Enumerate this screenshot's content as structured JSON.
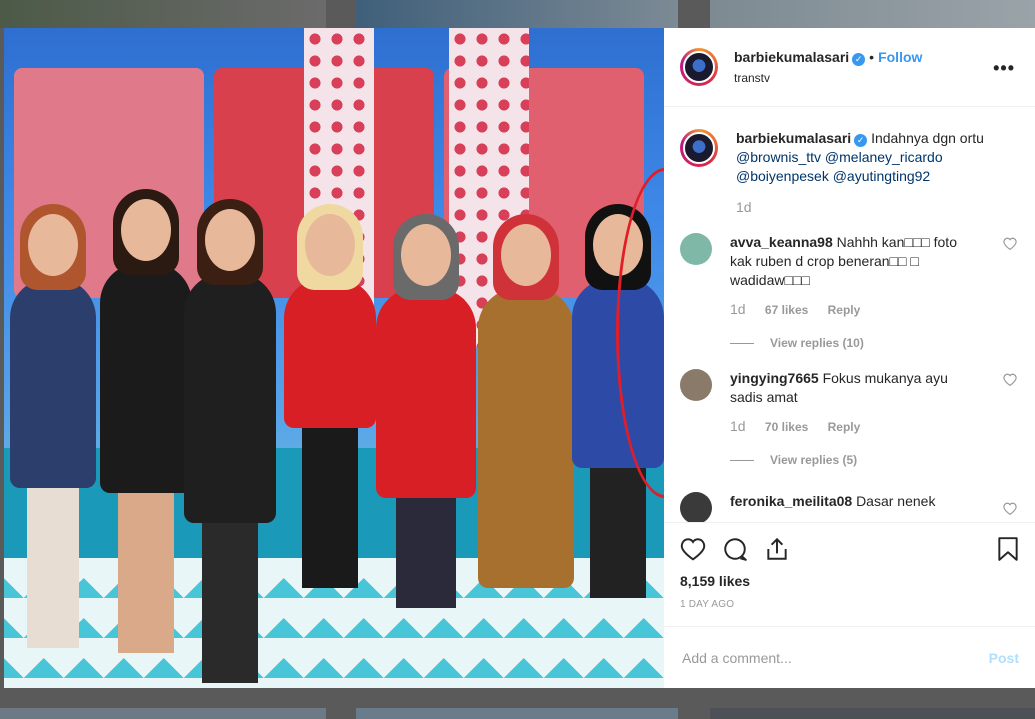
{
  "post": {
    "username": "barbiekumalasari",
    "follow_label": "Follow",
    "location": "transtv",
    "more_label": "•••"
  },
  "caption": {
    "username": "barbiekumalasari",
    "text_before": "Indahnya dgn ortu",
    "mentions": [
      "@brownis_ttv",
      "@melaney_ricardo",
      "@boiyenpesek",
      "@ayutingting92"
    ],
    "time": "1d"
  },
  "comments": [
    {
      "username": "avva_keanna98",
      "text": "Nahhh kan□□□ foto kak ruben d crop beneran□□ □ wadidaw□□□",
      "time": "1d",
      "likes": "67 likes",
      "reply_label": "Reply",
      "view_replies": "View replies (10)",
      "avatar_color": "#7fb8a6"
    },
    {
      "username": "yingying7665",
      "text": "Fokus mukanya ayu sadis amat",
      "time": "1d",
      "likes": "70 likes",
      "reply_label": "Reply",
      "view_replies": "View replies (5)",
      "avatar_color": "#8a7a6a"
    },
    {
      "username": "feronika_meilita08",
      "text": "Dasar nenek",
      "avatar_color": "#3a3a3a"
    }
  ],
  "likes_count": "8,159 likes",
  "posted_ago": "1 DAY AGO",
  "add_comment_placeholder": "Add a comment...",
  "post_label": "Post",
  "icons": [
    "heart-icon",
    "comment-icon",
    "share-icon",
    "bookmark-icon",
    "verified-icon",
    "more-icon"
  ],
  "colors": {
    "link": "#3897f0",
    "mention": "#003569",
    "annotation": "#e01e2a"
  }
}
